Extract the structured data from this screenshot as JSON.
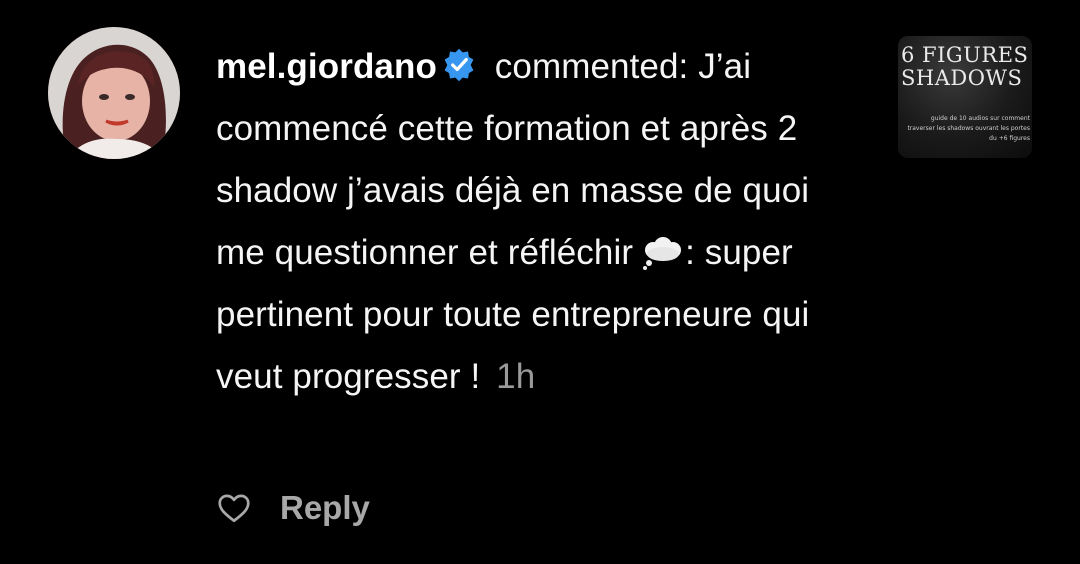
{
  "comment": {
    "username": "mel.giordano",
    "action": "commented:",
    "text_before_emoji": "J’ai commencé cette formation et après 2 shadow j’avais déjà en masse de quoi me questionner et réfléchir",
    "emoji": "💭",
    "text_after_emoji": ": super pertinent pour toute entrepreneure qui veut progresser !",
    "time": "1h"
  },
  "actions": {
    "reply_label": "Reply"
  },
  "thumbnail": {
    "title_line1": "6 FIGURES",
    "title_line2": "SHADOWS",
    "subtitle": "guide de 10 audios sur comment traverser les shadows ouvrant les portes du +6 figures"
  },
  "colors": {
    "background": "#000000",
    "text": "#f5f5f5",
    "muted": "#9a9a9a",
    "verified_badge": "#3797f0"
  },
  "icons": {
    "avatar": "profile-photo",
    "verified": "verified-badge-icon",
    "thought_bubble": "thought-balloon-emoji",
    "heart": "heart-outline-icon"
  }
}
